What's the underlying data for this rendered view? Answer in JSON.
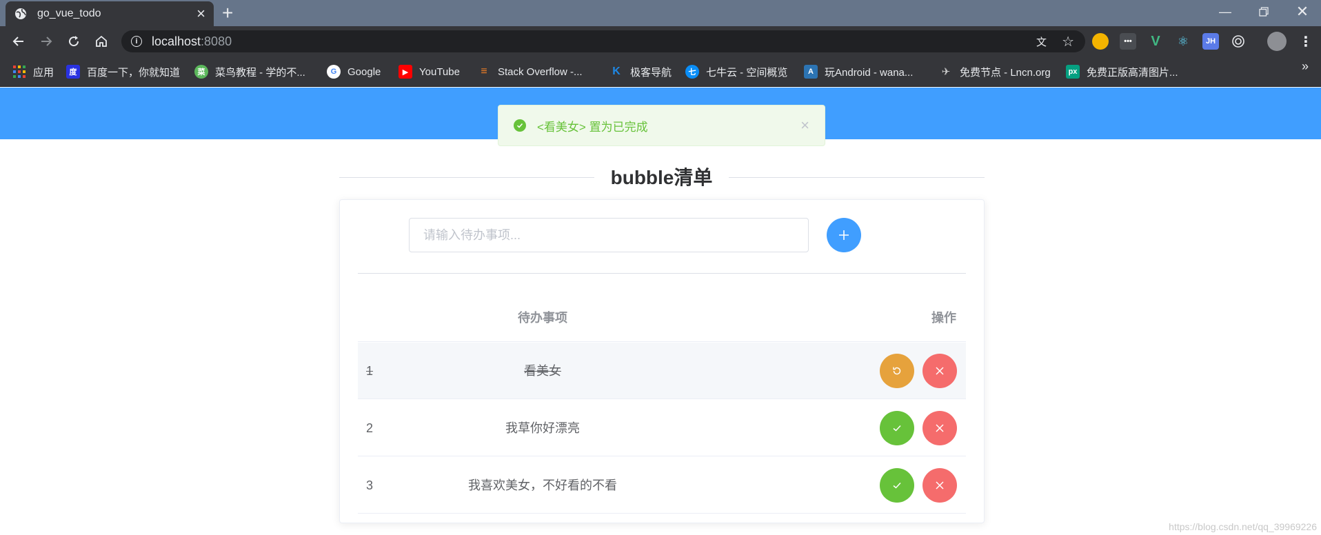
{
  "browser": {
    "tab_title": "go_vue_todo",
    "url_host": "localhost",
    "url_port": ":8080",
    "bookmarks": [
      {
        "label": "应用",
        "color": "#ea4335"
      },
      {
        "label": "百度一下，你就知道",
        "color": "#2932e1"
      },
      {
        "label": "菜鸟教程 - 学的不...",
        "color": "#5cb85c"
      },
      {
        "label": "Google",
        "color": "#4285f4"
      },
      {
        "label": "YouTube",
        "color": "#ff0000"
      },
      {
        "label": "Stack Overflow -...",
        "color": "#f48024"
      },
      {
        "label": "极客导航",
        "color": "#1e88e5"
      },
      {
        "label": "七牛云 - 空间概览",
        "color": "#0a8ef7"
      },
      {
        "label": "玩Android - wana...",
        "color": "#2c74b3"
      },
      {
        "label": "免费节点 - Lncn.org",
        "color": "#8e8e8e"
      },
      {
        "label": "免费正版高清图片...",
        "color": "#05a081"
      }
    ],
    "more": "»"
  },
  "message": {
    "text": "<看美女> 置为已完成",
    "type": "success",
    "color": "#67c23a"
  },
  "page": {
    "title": "bubble清单",
    "band_color": "#409eff"
  },
  "input": {
    "placeholder": "请输入待办事项..."
  },
  "table": {
    "headers": {
      "item": "待办事项",
      "action": "操作"
    },
    "rows": [
      {
        "num": "1",
        "item": "看美女",
        "done": true
      },
      {
        "num": "2",
        "item": "我草你好漂亮",
        "done": false
      },
      {
        "num": "3",
        "item": "我喜欢美女，不好看的不看",
        "done": false
      }
    ]
  },
  "watermark": "https://blog.csdn.net/qq_39969226"
}
